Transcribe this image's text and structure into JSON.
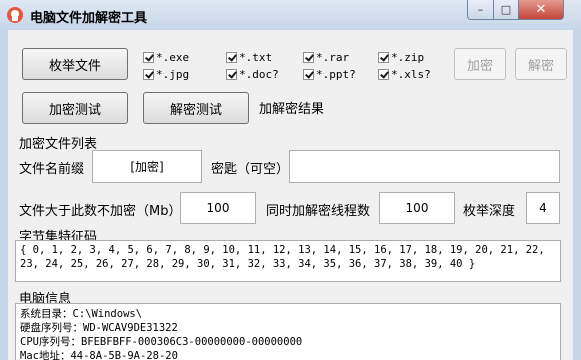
{
  "window": {
    "title": "电脑文件加解密工具"
  },
  "toolbar": {
    "enumerate_label": "枚举文件",
    "encrypt_label": "加密",
    "decrypt_label": "解密",
    "encrypt_test_label": "加密测试",
    "decrypt_test_label": "解密测试",
    "result_label": "加解密结果"
  },
  "filetypes": [
    "*.exe",
    "*.txt",
    "*.rar",
    "*.zip",
    "*.jpg",
    "*.doc?",
    "*.ppt?",
    "*.xls?"
  ],
  "list_title": "加密文件列表",
  "prefix": {
    "label": "文件名前缀",
    "value": "[加密]"
  },
  "key": {
    "label": "密匙（可空）",
    "value": ""
  },
  "size_limit": {
    "label": "文件大于此数不加密（Mb）",
    "value": "100"
  },
  "threads": {
    "label": "同时加解密线程数",
    "value": "100"
  },
  "depth": {
    "label": "枚举深度",
    "value": "4"
  },
  "charset": {
    "label": "字节集特征码",
    "line1": "{ 0, 1, 2, 3, 4, 5, 6, 7, 8, 9, 10, 11, 12, 13, 14, 15, 16, 17, 18, 19, 20, 21, 22,",
    "line2": "23, 24, 25, 26, 27, 28, 29, 30, 31, 32, 33, 34, 35, 36, 37, 38, 39, 40 }"
  },
  "pcinfo": {
    "label": "电脑信息",
    "lines": [
      "系统目录：C:\\Windows\\",
      "硬盘序列号：WD-WCAV9DE31322",
      "CPU序列号：BFEBFBFF-000306C3-00000000-00000000",
      "Mac地址：44-8A-5B-9A-28-20"
    ]
  }
}
